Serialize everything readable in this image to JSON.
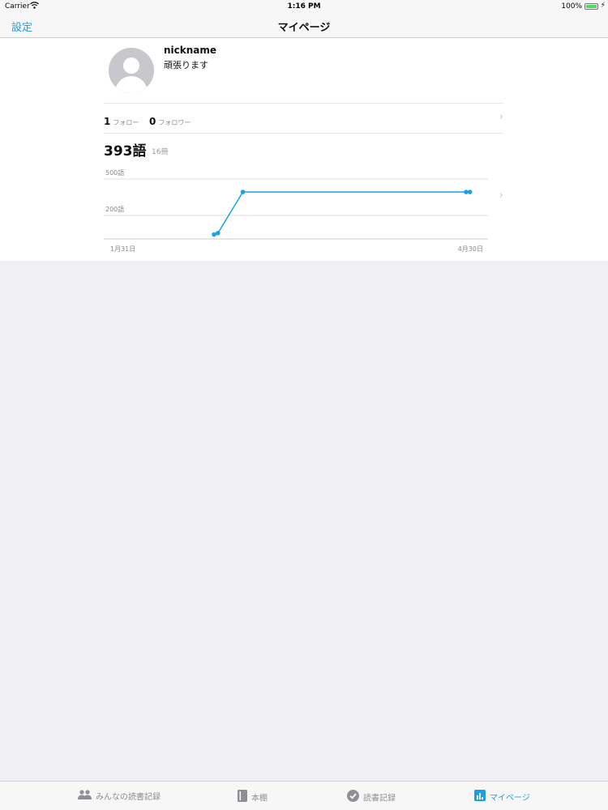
{
  "status_bar": {
    "carrier": "Carrier",
    "time": "1:16 PM",
    "battery": "100%"
  },
  "nav": {
    "left_button": "設定",
    "title": "マイページ"
  },
  "profile": {
    "nickname": "nickname",
    "bio": "頑張ります"
  },
  "follow": {
    "following_count": "1",
    "following_label": "フォロー",
    "followers_count": "0",
    "followers_label": "フォロワー"
  },
  "stats": {
    "total_words": "393語",
    "book_count": "16冊"
  },
  "chart_data": {
    "type": "line",
    "x": [
      "1月31日",
      "",
      "",
      "",
      "",
      "4月30日"
    ],
    "xtick_labels": [
      "1月31日",
      "4月30日"
    ],
    "ytick_labels": [
      "500語",
      "200語"
    ],
    "series": [
      {
        "points": [
          {
            "x": 0.287,
            "y": 38
          },
          {
            "x": 0.297,
            "y": 50
          },
          {
            "x": 0.362,
            "y": 393
          },
          {
            "x": 0.943,
            "y": 393
          },
          {
            "x": 0.953,
            "y": 393
          }
        ]
      }
    ],
    "ylim": [
      0,
      500
    ],
    "line_color": "#1aa3e0"
  },
  "tabs": [
    {
      "label": "みんなの読書記録",
      "icon": "people-icon",
      "active": false
    },
    {
      "label": "本棚",
      "icon": "book-icon",
      "active": false
    },
    {
      "label": "読書記録",
      "icon": "checkmark-circle-icon",
      "active": false
    },
    {
      "label": "マイページ",
      "icon": "bar-chart-icon",
      "active": true
    }
  ],
  "colors": {
    "accent": "#1a9fe0",
    "background": "#efeff4"
  }
}
